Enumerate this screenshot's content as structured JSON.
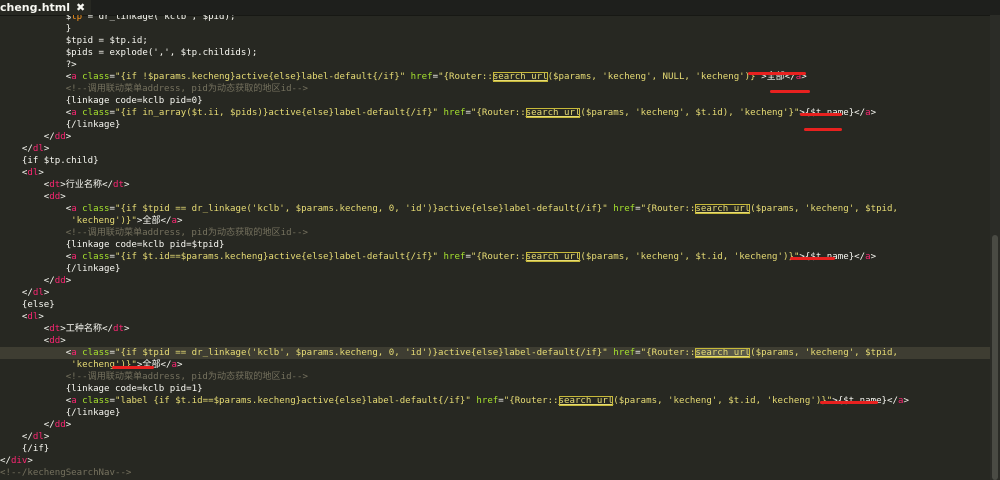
{
  "tab": {
    "title": "cheng.html",
    "close_glyph": "✖"
  },
  "theme": {
    "bg": "#272822",
    "tag": "#f92672",
    "attr": "#a6e22e",
    "string": "#e6db74",
    "variable": "#fd971f",
    "comment": "#75715e",
    "function": "#66d9ef",
    "plain": "#f8f8f2",
    "underline_red": "#e8211f"
  },
  "lines": [
    [
      [
        "p",
        "            $"
      ],
      [
        "v",
        "tp"
      ],
      [
        "p",
        " = dr_linkage('kclb', $pid);"
      ]
    ],
    [
      [
        "p",
        "            }"
      ]
    ],
    [
      [
        "p",
        "            $tpid = $tp.id;"
      ]
    ],
    [
      [
        "p",
        "            $pids = explode(',', $tp.childids);"
      ]
    ],
    [
      [
        "p",
        "            ?>"
      ]
    ],
    [
      [
        "p",
        "            <"
      ],
      [
        "t",
        "a"
      ],
      [
        "p",
        " "
      ],
      [
        "a",
        "class"
      ],
      [
        "p",
        "="
      ],
      [
        "s",
        "\"{if !$params.kecheng}active{else}label-default{/if}\""
      ],
      [
        "p",
        " "
      ],
      [
        "a",
        "href"
      ],
      [
        "p",
        "="
      ],
      [
        "s",
        "\"{Router::"
      ],
      [
        "sh",
        "search_url"
      ],
      [
        "s",
        "($params, 'kecheng', NULL, 'kecheng')}\""
      ],
      [
        "p",
        ">全部</"
      ],
      [
        "t",
        "a"
      ],
      [
        "p",
        ">"
      ]
    ],
    [
      [
        "c",
        "            <!--调用联动菜单address, pid为动态获取的地区id-->"
      ]
    ],
    [
      [
        "p",
        "            {linkage code=kclb pid=0}"
      ]
    ],
    [
      [
        "p",
        "            <"
      ],
      [
        "t",
        "a"
      ],
      [
        "p",
        " "
      ],
      [
        "a",
        "class"
      ],
      [
        "p",
        "="
      ],
      [
        "s",
        "\"{if in_array($t.ii, $pids)}active{else}label-default{/if}\""
      ],
      [
        "p",
        " "
      ],
      [
        "a",
        "href"
      ],
      [
        "p",
        "="
      ],
      [
        "s",
        "\"{Router::"
      ],
      [
        "sh",
        "search_url"
      ],
      [
        "s",
        "($params, 'kecheng', $t.id), 'kecheng'}\""
      ],
      [
        "p",
        ">{$t.name}</"
      ],
      [
        "t",
        "a"
      ],
      [
        "p",
        ">"
      ]
    ],
    [
      [
        "p",
        "            {/linkage}"
      ]
    ],
    [
      [
        "p",
        "        </"
      ],
      [
        "t",
        "dd"
      ],
      [
        "p",
        ">"
      ]
    ],
    [
      [
        "p",
        "    </"
      ],
      [
        "t",
        "dl"
      ],
      [
        "p",
        ">"
      ]
    ],
    [
      [
        "p",
        "    {if $tp.child}"
      ]
    ],
    [
      [
        "p",
        "    <"
      ],
      [
        "t",
        "dl"
      ],
      [
        "p",
        ">"
      ]
    ],
    [
      [
        "p",
        "        <"
      ],
      [
        "t",
        "dt"
      ],
      [
        "p",
        ">行业名称</"
      ],
      [
        "t",
        "dt"
      ],
      [
        "p",
        ">"
      ]
    ],
    [
      [
        "p",
        "        <"
      ],
      [
        "t",
        "dd"
      ],
      [
        "p",
        ">"
      ]
    ],
    [
      [
        "p",
        "            <"
      ],
      [
        "t",
        "a"
      ],
      [
        "p",
        " "
      ],
      [
        "a",
        "class"
      ],
      [
        "p",
        "="
      ],
      [
        "s",
        "\"{if $tpid == dr_linkage('kclb', $params.kecheng, 0, 'id')}active{else}label-default{/if}\""
      ],
      [
        "p",
        " "
      ],
      [
        "a",
        "href"
      ],
      [
        "p",
        "="
      ],
      [
        "s",
        "\"{Router::"
      ],
      [
        "sh",
        "search_url"
      ],
      [
        "s",
        "($params, 'kecheng', $tpid,"
      ]
    ],
    [
      [
        "s",
        "             'kecheng')}\""
      ],
      [
        "p",
        ">全部</"
      ],
      [
        "t",
        "a"
      ],
      [
        "p",
        ">"
      ]
    ],
    [
      [
        "c",
        "            <!--调用联动菜单address, pid为动态获取的地区id-->"
      ]
    ],
    [
      [
        "p",
        "            {linkage code=kclb pid=$tpid}"
      ]
    ],
    [
      [
        "p",
        "            <"
      ],
      [
        "t",
        "a"
      ],
      [
        "p",
        " "
      ],
      [
        "a",
        "class"
      ],
      [
        "p",
        "="
      ],
      [
        "s",
        "\"{if $t.id==$params.kecheng}active{else}label-default{/if}\""
      ],
      [
        "p",
        " "
      ],
      [
        "a",
        "href"
      ],
      [
        "p",
        "="
      ],
      [
        "s",
        "\"{Router::"
      ],
      [
        "sh",
        "search_url"
      ],
      [
        "s",
        "($params, 'kecheng', $t.id, 'kecheng')}\""
      ],
      [
        "p",
        ">{$t.name}</"
      ],
      [
        "t",
        "a"
      ],
      [
        "p",
        ">"
      ]
    ],
    [
      [
        "p",
        "            {/linkage}"
      ]
    ],
    [
      [
        "p",
        "        </"
      ],
      [
        "t",
        "dd"
      ],
      [
        "p",
        ">"
      ]
    ],
    [
      [
        "p",
        "    </"
      ],
      [
        "t",
        "dl"
      ],
      [
        "p",
        ">"
      ]
    ],
    [
      [
        "p",
        "    {else}"
      ]
    ],
    [
      [
        "p",
        "    <"
      ],
      [
        "t",
        "dl"
      ],
      [
        "p",
        ">"
      ]
    ],
    [
      [
        "p",
        "        <"
      ],
      [
        "t",
        "dt"
      ],
      [
        "p",
        ">工种名称</"
      ],
      [
        "t",
        "dt"
      ],
      [
        "p",
        ">"
      ]
    ],
    [
      [
        "p",
        "        <"
      ],
      [
        "t",
        "dd"
      ],
      [
        "p",
        ">"
      ]
    ],
    [
      [
        "p",
        "            <"
      ],
      [
        "t",
        "a"
      ],
      [
        "p",
        " "
      ],
      [
        "a",
        "class"
      ],
      [
        "p",
        "="
      ],
      [
        "s",
        "\"{if $tpid == dr_linkage('kclb', $params.kecheng, 0, 'id')}active{else}label-default{/if}\""
      ],
      [
        "p",
        " "
      ],
      [
        "a",
        "href"
      ],
      [
        "p",
        "="
      ],
      [
        "s",
        "\"{Router::"
      ],
      [
        "sx",
        "search_url"
      ],
      [
        "s",
        "($params, 'kecheng', $tpid,"
      ]
    ],
    [
      [
        "s",
        "             'kecheng')}\""
      ],
      [
        "p",
        ">全部</"
      ],
      [
        "t",
        "a"
      ],
      [
        "p",
        ">"
      ]
    ],
    [
      [
        "c",
        "            <!--调用联动菜单address, pid为动态获取的地区id-->"
      ]
    ],
    [
      [
        "p",
        "            {linkage code=kclb pid=1}"
      ]
    ],
    [
      [
        "p",
        "            <"
      ],
      [
        "t",
        "a"
      ],
      [
        "p",
        " "
      ],
      [
        "a",
        "class"
      ],
      [
        "p",
        "="
      ],
      [
        "s",
        "\"label {if $t.id==$params.kecheng}active{else}label-default{/if}\""
      ],
      [
        "p",
        " "
      ],
      [
        "a",
        "href"
      ],
      [
        "p",
        "="
      ],
      [
        "s",
        "\"{Router::"
      ],
      [
        "sh",
        "search_url"
      ],
      [
        "s",
        "($params, 'kecheng', $t.id, 'kecheng')}\""
      ],
      [
        "p",
        ">{$t.name}</"
      ],
      [
        "t",
        "a"
      ],
      [
        "p",
        ">"
      ]
    ],
    [
      [
        "p",
        "            {/linkage}"
      ]
    ],
    [
      [
        "p",
        "        </"
      ],
      [
        "t",
        "dd"
      ],
      [
        "p",
        ">"
      ]
    ],
    [
      [
        "p",
        "    </"
      ],
      [
        "t",
        "dl"
      ],
      [
        "p",
        ">"
      ]
    ],
    [
      [
        "p",
        "    {/if}"
      ]
    ],
    [
      [
        "p",
        "</"
      ],
      [
        "t",
        "div"
      ],
      [
        "p",
        ">"
      ]
    ],
    [
      [
        "c",
        "<!--/kechengSearchNav-->"
      ]
    ]
  ]
}
